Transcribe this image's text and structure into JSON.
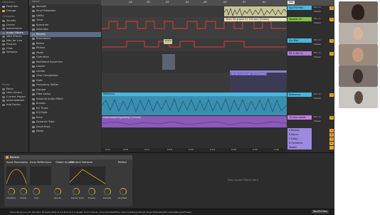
{
  "ruler": {
    "marks": [
      "-13",
      "-29",
      "-37",
      "-41",
      "-49",
      "-53",
      "-57",
      "-61"
    ],
    "bottom_marks": [
      "0:04",
      "0:08",
      "0:12",
      "0:16",
      "0:20",
      "0:24",
      "0:28",
      "0:32",
      "0:36",
      "0:40",
      "0:44"
    ]
  },
  "collections": {
    "header": "Collections",
    "items": [
      "Favorites",
      "Orange"
    ],
    "categories_header": "Categories",
    "categories": [
      "Sounds",
      "Drums",
      "Instruments",
      "Audio Effects",
      "MIDI Effects",
      "Max for Live",
      "Plug-ins",
      "Clips",
      "Samples"
    ],
    "places_header": "Places",
    "places": [
      "Packs",
      "User Library",
      "Current Project",
      "Intermediate5",
      "Add Folder..."
    ]
  },
  "browser": {
    "header": "Name",
    "items": [
      "Vocoder",
      "Vinyl Distortion",
      "Utility",
      "Tuner",
      "Spectrum",
      "Saturator",
      "Reverb",
      "Resonators",
      "Redux",
      "Phaser",
      "Pedal",
      "Overdrive",
      "Multiband Dynamics",
      "Looper",
      "Limiter",
      "Glue Compressor",
      "Gate",
      "Frequency Shifter",
      "Flanger",
      "Filter Delay",
      "External Audio Effect",
      "Erosion",
      "EQ Three",
      "EQ Eight",
      "Echo",
      "Dynamic Tube",
      "Drum Buss",
      "Delay"
    ]
  },
  "clips": {
    "top": "Token Kit groove 01 100 bpm [Freeze]",
    "midi": "06 MU in the Left 120 [Freeze]",
    "reference": "Reference",
    "long": "Intermediate5\\greeting1 (Freeze)",
    "small": "Crash",
    "marker": "Set"
  },
  "tracks": [
    {
      "name": "Top EFX Perc",
      "color": "#48b6e0",
      "num": "1"
    },
    {
      "name": "Speaker On",
      "color": "#7cc242",
      "num": "2"
    },
    {
      "name": "Dry Mod",
      "color": "#48b6e0",
      "num": "3"
    },
    {
      "name": "M1 In the Le",
      "color": "#b07fd8",
      "num": "4"
    },
    {
      "name": "Reference",
      "color": "#48b6e0",
      "num": "5"
    },
    {
      "name": "10 Intermediat",
      "color": "#c07fe0",
      "num": "6"
    },
    {
      "name": "A Reverb",
      "color": "#9b8ae0",
      "num": "A"
    },
    {
      "name": "B Return",
      "color": "#9b8ae0",
      "num": "B"
    },
    {
      "name": "C Delay",
      "color": "#9b8ae0",
      "num": "C"
    },
    {
      "name": "D Overdrive",
      "color": "#9b8ae0",
      "num": "D"
    },
    {
      "name": "Master",
      "color": "#9b8ae0",
      "num": ""
    }
  ],
  "track_io": {
    "in": "Ext. In",
    "out": "Master"
  },
  "device": {
    "name": "Reverb",
    "sections": [
      "Input Processing",
      "Early Reflections",
      "Global Quality",
      "Diffusion Network",
      "Reflect"
    ],
    "values": [
      "Lo Cut",
      "Hi Cut",
      "Spin",
      "Shape",
      "Predelay",
      "Size",
      "Stereo",
      "Decay Time",
      "Freeze",
      "Density",
      "Scale",
      "Dry/Wet"
    ],
    "drop_hint": "Drop Audio Effects Here"
  },
  "status": {
    "left": "Token Kit groove 01 100 bpm (Freeze) Start: 0.1.1 End: 8.1.1 Length: 8.0.0 /Users/.../Documents/MMS's Intermediate/greeting1 Project/Samples/Processed/Reverb/Freeze/",
    "right": "Top EFX Perc"
  }
}
